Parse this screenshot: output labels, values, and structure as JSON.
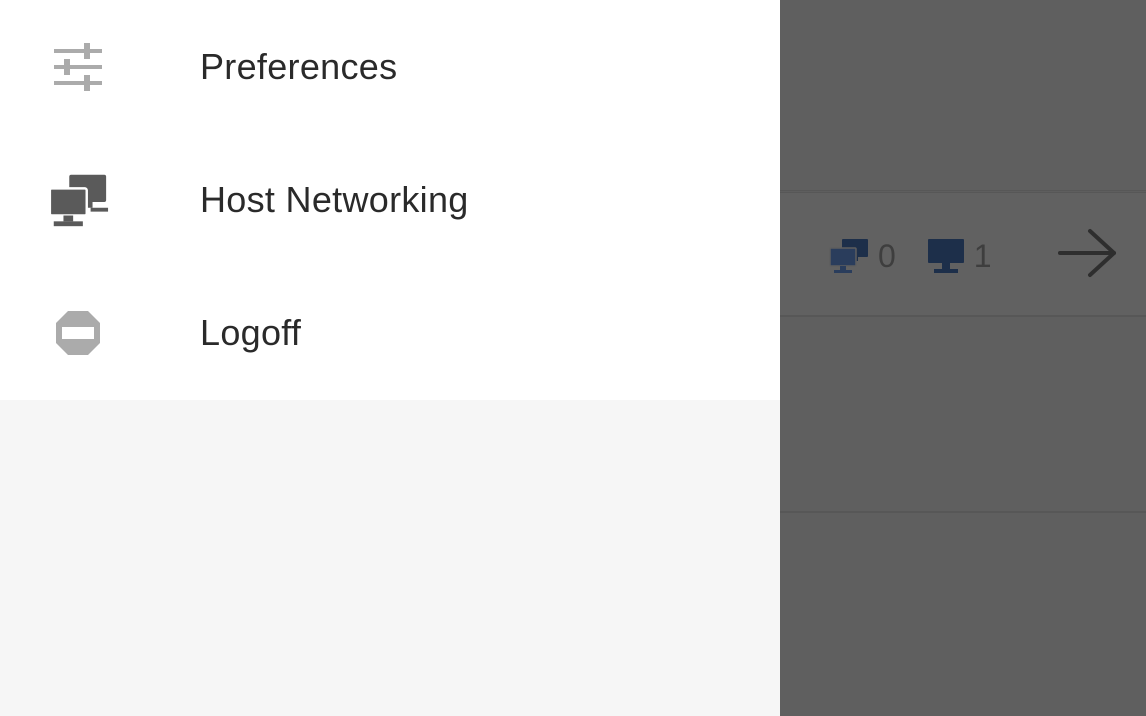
{
  "drawer": {
    "items": [
      {
        "label": "Preferences",
        "icon": "sliders-icon"
      },
      {
        "label": "Host Networking",
        "icon": "networked-computers-icon"
      },
      {
        "label": "Logoff",
        "icon": "logoff-icon"
      }
    ]
  },
  "background": {
    "host_card": {
      "network_count": "0",
      "computer_count": "1",
      "network_icon": "networked-computers-icon",
      "computer_icon": "computer-icon",
      "action_icon": "arrow-right-icon"
    }
  },
  "colors": {
    "drawer_menu_bg": "#ffffff",
    "drawer_bg": "#f6f6f6",
    "scrim": "#5e5e5e",
    "icon_gray": "#a7a7a7",
    "icon_dark": "#5a5a5a",
    "bg_icon_blue": "#1d2f4a"
  }
}
